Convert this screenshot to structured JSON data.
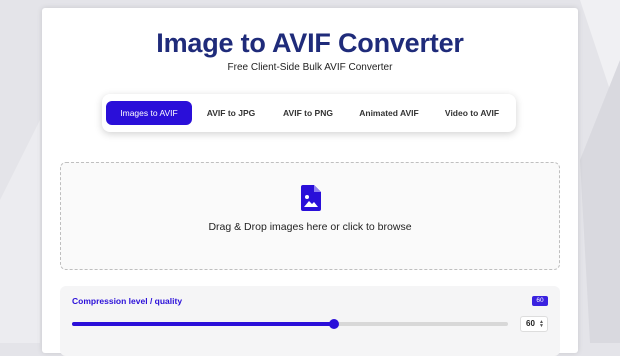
{
  "header": {
    "title": "Image to AVIF Converter",
    "subtitle": "Free Client-Side Bulk AVIF Converter"
  },
  "tabs": [
    {
      "label": "Images to AVIF",
      "active": true
    },
    {
      "label": "AVIF to JPG",
      "active": false
    },
    {
      "label": "AVIF to PNG",
      "active": false
    },
    {
      "label": "Animated AVIF",
      "active": false
    },
    {
      "label": "Video to AVIF",
      "active": false
    }
  ],
  "dropzone": {
    "icon": "image-file-icon",
    "text": "Drag & Drop images here or click to browse"
  },
  "quality": {
    "label": "Compression level / quality",
    "badge": "60",
    "value": "60",
    "level_percent": 60
  },
  "colors": {
    "accent": "#2a0fd9",
    "title": "#1f2b7a"
  }
}
